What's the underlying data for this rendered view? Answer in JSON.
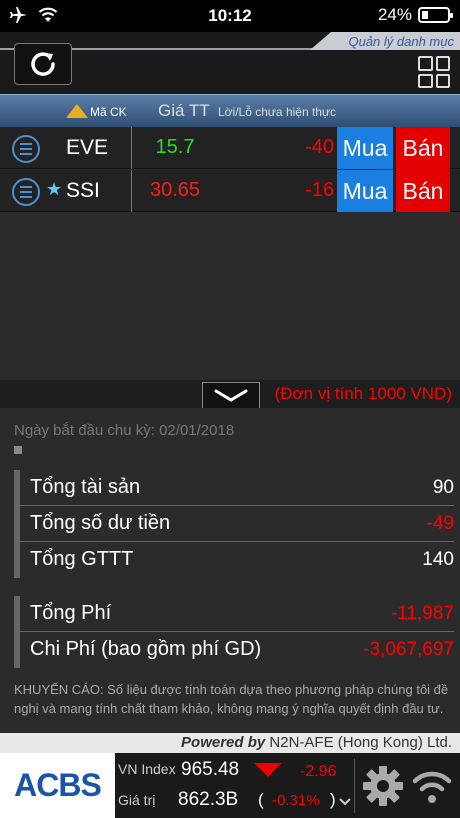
{
  "status_bar": {
    "time": "10:12",
    "battery": "24%"
  },
  "toolbar": {
    "tab_label": "Quản lý danh mục"
  },
  "table": {
    "headers": {
      "code": "Mã CK",
      "price": "Giá TT",
      "pl": "Lời/Lỗ chưa hiện thực"
    },
    "rows": [
      {
        "code": "EVE",
        "starred": false,
        "price": "15.7",
        "price_color": "#22dd22",
        "pl": "-40",
        "buy": "Mua",
        "sell": "Bán"
      },
      {
        "code": "SSI",
        "starred": true,
        "price": "30.65",
        "price_color": "#ff1a1a",
        "pl": "-16",
        "buy": "Mua",
        "sell": "Bán"
      }
    ]
  },
  "unit_bar": {
    "text": "(Đơn vị tính 1000 VND)"
  },
  "summary": {
    "start_date": "Ngày bắt đầu chu kỳ: 02/01/2018",
    "group1": [
      {
        "label": "Tổng tài sản",
        "value": "90"
      },
      {
        "label": "Tổng số dư tiền",
        "value": "-49"
      },
      {
        "label": "Tổng GTTT",
        "value": "140"
      }
    ],
    "group2": [
      {
        "label": "Tổng Phí",
        "value": "-11,987"
      },
      {
        "label": "Chi Phí (bao gồm phí GD)",
        "value": "-3,067,697"
      }
    ],
    "disclaimer": "KHUYẾN CÁO: Số liệu được tính toán dựa theo phương pháp chúng tôi đề nghị và mang tính chất tham khảo, không mang ý nghĩa quyết định đầu tư."
  },
  "powered": {
    "prefix": "Powered by",
    "company": " N2N-AFE (Hong Kong) Ltd."
  },
  "bottom_bar": {
    "logo": "ACBS",
    "index_label": "VN Index",
    "index_value": "965.48",
    "index_change": "-2.96",
    "value_label": "Giá trị",
    "value_amount": "862.3B",
    "open_paren": "(",
    "value_pct": "-0.31%",
    "close_paren": ")"
  },
  "icons": {
    "refresh": "refresh-icon",
    "grid": "grid-view-icon",
    "row_menu": "list-menu-icon",
    "star": "star-icon",
    "sort": "sort-triangle-icon",
    "expand": "chevron-down-icon",
    "settings": "gear-icon",
    "wifi": "wifi-icon"
  }
}
